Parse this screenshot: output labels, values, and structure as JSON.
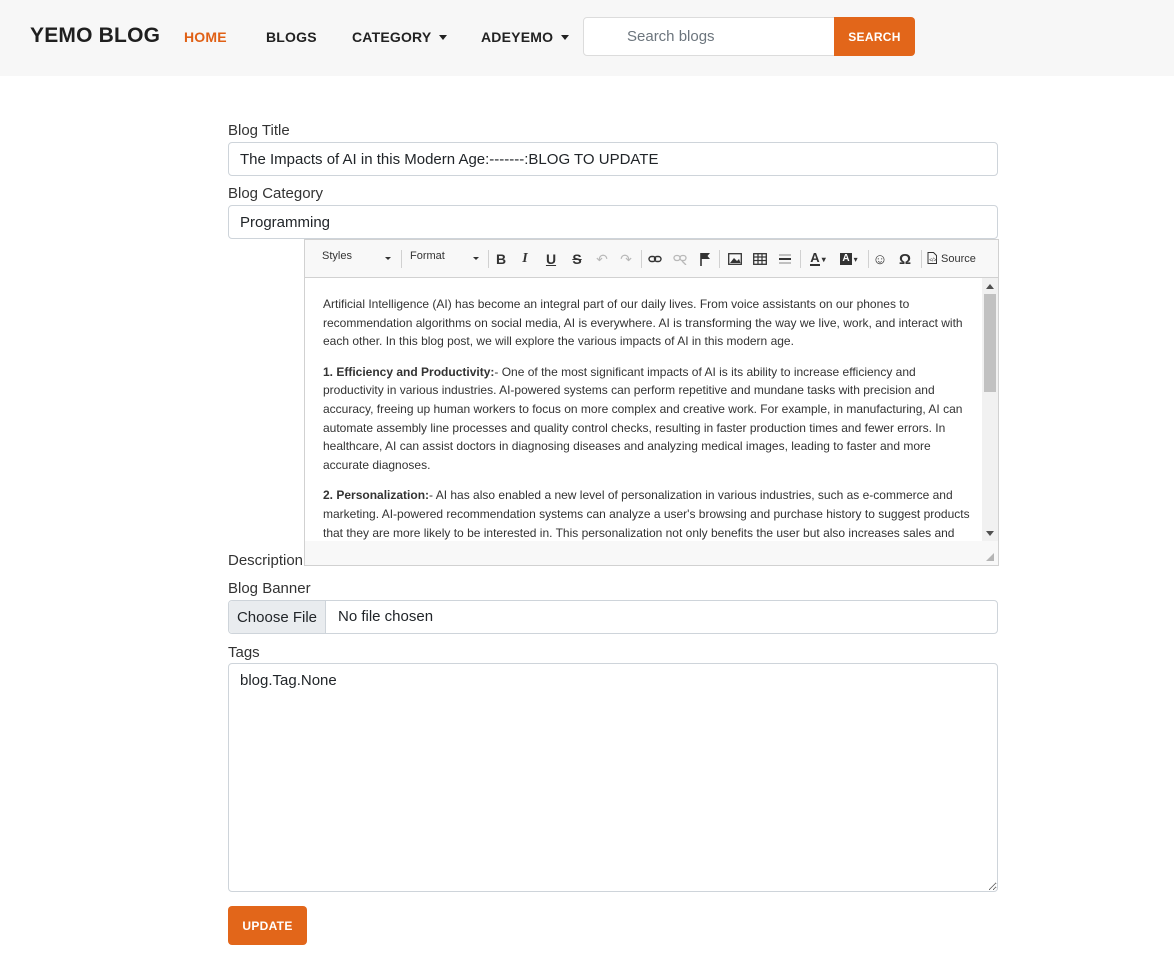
{
  "nav": {
    "brand": "YEMO BLOG",
    "links": {
      "home": "HOME",
      "blogs": "BLOGS",
      "category": "CATEGORY",
      "user": "ADEYEMO"
    },
    "active": "HOME",
    "search_placeholder": "Search blogs",
    "search_button": "SEARCH"
  },
  "form": {
    "title_label": "Blog Title",
    "title_value": "The Impacts of AI in this Modern Age:-------:BLOG TO UPDATE",
    "category_label": "Blog Category",
    "category_value": "Programming",
    "description_label": "Description",
    "banner_label": "Blog Banner",
    "file_button": "Choose File",
    "file_status": "No file chosen",
    "tags_label": "Tags",
    "tags_value": "blog.Tag.None",
    "update_button": "UPDATE"
  },
  "editor": {
    "toolbar": {
      "styles": "Styles",
      "format": "Format",
      "source": "Source",
      "icons": [
        "bold-icon",
        "italic-icon",
        "underline-icon",
        "strikethrough-icon",
        "undo-icon",
        "redo-icon",
        "link-icon",
        "unlink-icon",
        "anchor-flag-icon",
        "image-icon",
        "table-icon",
        "horizontal-line-icon",
        "text-color-icon",
        "background-color-icon",
        "smiley-icon",
        "special-character-icon",
        "source-icon"
      ]
    },
    "content": {
      "intro": "Artificial Intelligence (AI) has become an integral part of our daily lives. From voice assistants on our phones to recommendation algorithms on social media, AI is everywhere. AI is transforming the way we live, work, and interact with each other. In this blog post, we will explore the various impacts of AI in this modern age.",
      "point1_heading": "1.  Efficiency and Productivity:",
      "point1_text": "- One of the most significant impacts of AI is its ability to increase efficiency and productivity in various industries. AI-powered systems can perform repetitive and mundane tasks with precision and accuracy, freeing up human workers to focus on more complex and creative work. For example, in manufacturing, AI can automate assembly line processes and quality control checks, resulting in faster production times and fewer errors. In healthcare, AI can assist doctors in diagnosing diseases and analyzing medical images, leading to faster and more accurate diagnoses.",
      "point2_heading": "2.  Personalization:",
      "point2_text": "- AI has also enabled a new level of personalization in various industries, such as e-commerce and marketing. AI-powered recommendation systems can analyze a user's browsing and purchase history to suggest products that they are more likely to be interested in. This personalization not only benefits the user but also increases sales and"
    }
  },
  "colors": {
    "accent": "#e2661a",
    "navbar_bg": "#f7f7f7"
  }
}
